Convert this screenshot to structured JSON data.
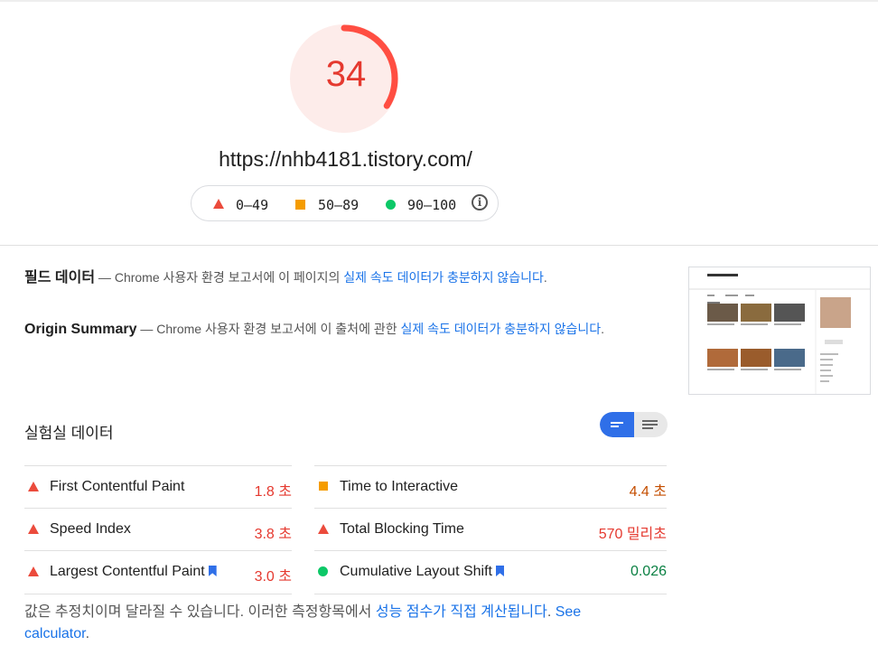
{
  "score": {
    "value": "34",
    "fraction": 0.34,
    "color": "#e5392f"
  },
  "url": "https://nhb4181.tistory.com/",
  "legend": {
    "fail": "0–49",
    "average": "50–89",
    "pass": "90–100"
  },
  "field_data": {
    "title": "필드 데이터",
    "dash": " — ",
    "text_prefix": "Chrome 사용자 환경 보고서에 이 페이지의 ",
    "link": "실제 속도 데이터가 충분하지 않습니다",
    "text_suffix": "."
  },
  "origin_summary": {
    "title": "Origin Summary",
    "dash": " — ",
    "text_prefix": "Chrome 사용자 환경 보고서에 이 출처에 관한 ",
    "link": "실제 속도 데이터가 충분하지 않습니다",
    "text_suffix": "."
  },
  "lab_data": {
    "title": "실험실 데이터"
  },
  "metrics": [
    {
      "label": "First Contentful Paint",
      "value": "1.8 초",
      "status": "fail",
      "bookmark": false
    },
    {
      "label": "Time to Interactive",
      "value": "4.4 초",
      "status": "average",
      "bookmark": false
    },
    {
      "label": "Speed Index",
      "value": "3.8 초",
      "status": "fail",
      "bookmark": false
    },
    {
      "label": "Total Blocking Time",
      "value": "570 밀리초",
      "status": "fail",
      "bookmark": false
    },
    {
      "label": "Largest Contentful Paint",
      "value": "3.0 초",
      "status": "fail",
      "bookmark": true
    },
    {
      "label": "Cumulative Layout Shift",
      "value": "0.026",
      "status": "pass",
      "bookmark": true
    }
  ],
  "note": {
    "text": "값은 추정치이며 달라질 수 있습니다. 이러한 측정항목에서 ",
    "link": "성능 점수가 직접 계산됩니다",
    "text2": ". ",
    "link2": "See calculator",
    "text3": "."
  },
  "colors": {
    "fail": "#e5392f",
    "average": "#c44e00",
    "pass": "#0b8043",
    "link": "#1a73e8"
  }
}
